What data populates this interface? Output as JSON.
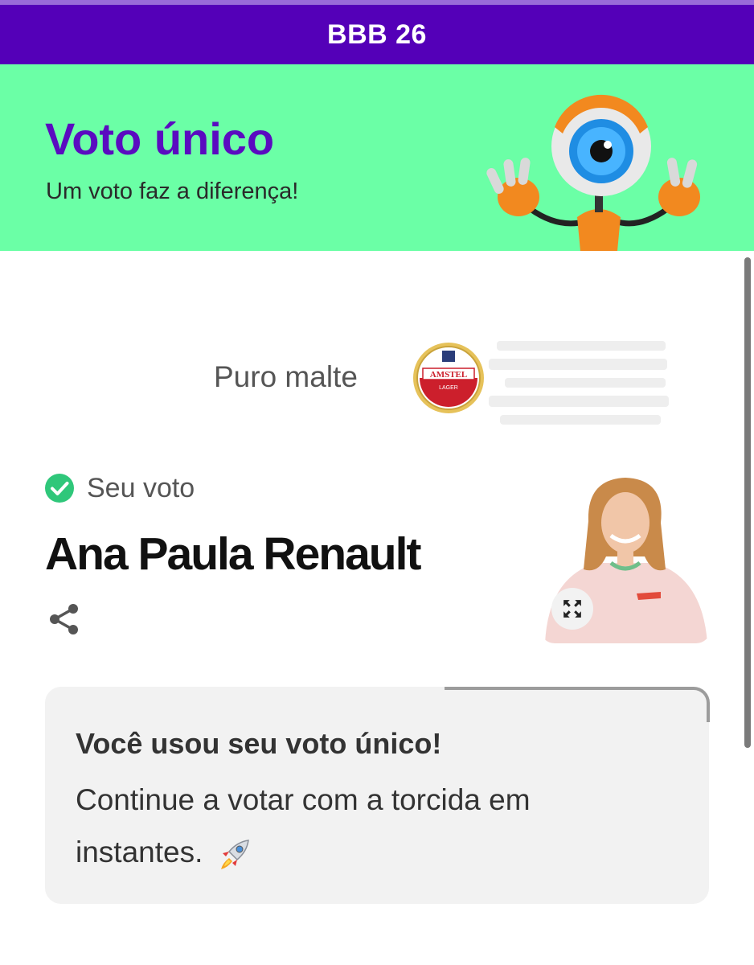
{
  "header": {
    "title": "BBB 26"
  },
  "hero": {
    "title": "Voto único",
    "subtitle": "Um voto faz a diferença!",
    "mascot_icon": "big-brother-eye-mascot"
  },
  "sponsor": {
    "label": "Puro malte",
    "logo_text": "AMSTEL",
    "logo_subtext": "LAGER"
  },
  "vote": {
    "status_label": "Seu voto",
    "candidate_name": "Ana Paula Renault",
    "share_icon": "share-icon",
    "expand_icon": "expand-icon"
  },
  "notice": {
    "title": "Você usou seu voto único!",
    "body": "Continue a votar com a torcida em instantes.",
    "emoji_icon": "rocket-icon"
  },
  "colors": {
    "brand_purple": "#5400b8",
    "hero_green": "#6bffa6",
    "title_purple": "#5a0bc0",
    "check_green": "#2fc77a",
    "card_bg": "#f2f2f2"
  }
}
